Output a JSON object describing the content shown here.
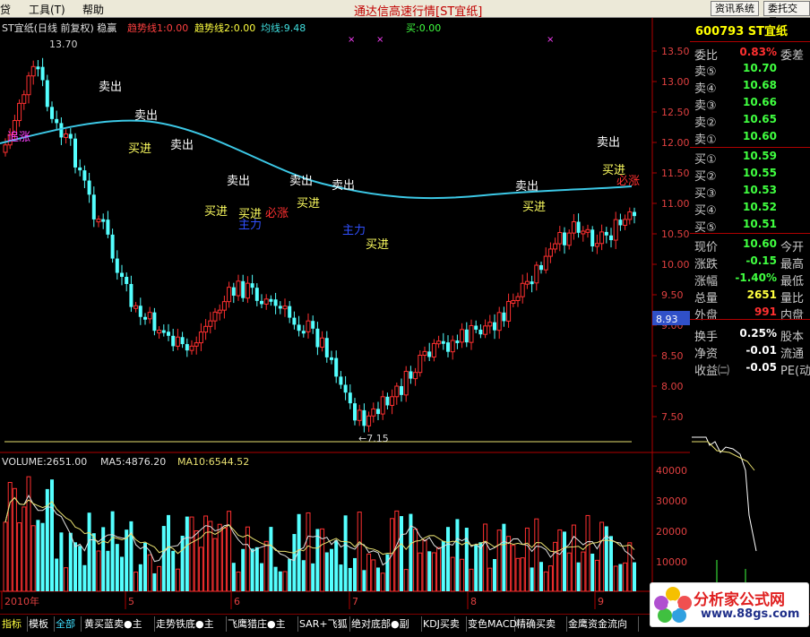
{
  "menu": {
    "item0": "贷",
    "tools": "工具(T)",
    "help": "帮助"
  },
  "app_title": "通达信高速行情[ST宜纸]",
  "buttons": {
    "info": "资讯系统",
    "trade": "委托交易"
  },
  "chart_header": {
    "name": "ST宜纸(日线 前复权) 稳赢",
    "trend1": "趋势线1:0.00",
    "trend2": "趋势线2:0.00",
    "ma": "均线:9.48",
    "buy": "买:0.00"
  },
  "price_axis": [
    "13.50",
    "13.00",
    "12.50",
    "12.00",
    "11.50",
    "11.00",
    "10.50",
    "10.00",
    "9.50",
    "9.00",
    "8.50",
    "8.00",
    "7.50"
  ],
  "current_price_tag": "8.93",
  "annotations": {
    "high": "13.70",
    "low": "←7.15",
    "sell": "卖出",
    "buy": "买进",
    "bizhang": "必涨",
    "zhuli": "主力",
    "zhuijin": "追涨"
  },
  "volume_header": {
    "vol": "VOLUME:2651.00",
    "ma5": "MA5:4876.20",
    "ma10": "MA10:6544.52"
  },
  "volume_axis": [
    "40000",
    "30000",
    "20000",
    "10000"
  ],
  "date_axis": [
    "2010年",
    "5",
    "6",
    "7",
    "8",
    "9"
  ],
  "quote": {
    "code": "600793 ST宜纸",
    "weibi": {
      "label": "委比",
      "value": "0.83%",
      "label2": "委差"
    },
    "asks": [
      {
        "label": "卖⑤",
        "price": "10.70"
      },
      {
        "label": "卖④",
        "price": "10.68"
      },
      {
        "label": "卖③",
        "price": "10.66"
      },
      {
        "label": "卖②",
        "price": "10.65"
      },
      {
        "label": "卖①",
        "price": "10.60"
      }
    ],
    "bids": [
      {
        "label": "买①",
        "price": "10.59"
      },
      {
        "label": "买②",
        "price": "10.55"
      },
      {
        "label": "买③",
        "price": "10.53"
      },
      {
        "label": "买④",
        "price": "10.52"
      },
      {
        "label": "买⑤",
        "price": "10.51"
      }
    ],
    "stats": [
      {
        "label": "现价",
        "value": "10.60",
        "label2": "今开"
      },
      {
        "label": "涨跌",
        "value": "-0.15",
        "label2": "最高"
      },
      {
        "label": "涨幅",
        "value": "-1.40%",
        "label2": "最低"
      },
      {
        "label": "总量",
        "value": "2651",
        "label2": "量比"
      },
      {
        "label": "外盘",
        "value": "991",
        "label2": "内盘"
      },
      {
        "label": "换手",
        "value": "0.25%",
        "label2": "股本"
      },
      {
        "label": "净资",
        "value": "-0.01",
        "label2": "流通"
      },
      {
        "label": "收益㈡",
        "value": "-0.05",
        "label2": "PE(动"
      }
    ]
  },
  "tabs": [
    "指标",
    "模板",
    "全部",
    "黄买蓝卖●主",
    "走势铁底●主",
    "飞鹰猎庄●主",
    "SAR+飞狐",
    "绝对底部●副",
    "KDJ买卖",
    "变色MACD",
    "精确买卖",
    "金鹰资金流向"
  ],
  "logo": {
    "cn": "分析家公式网",
    "url": "www.88gs.com"
  },
  "colors": {
    "up": "#FF3030",
    "down": "#54FFFF",
    "ma_line": "#3CC8E6",
    "bg": "#000000"
  }
}
